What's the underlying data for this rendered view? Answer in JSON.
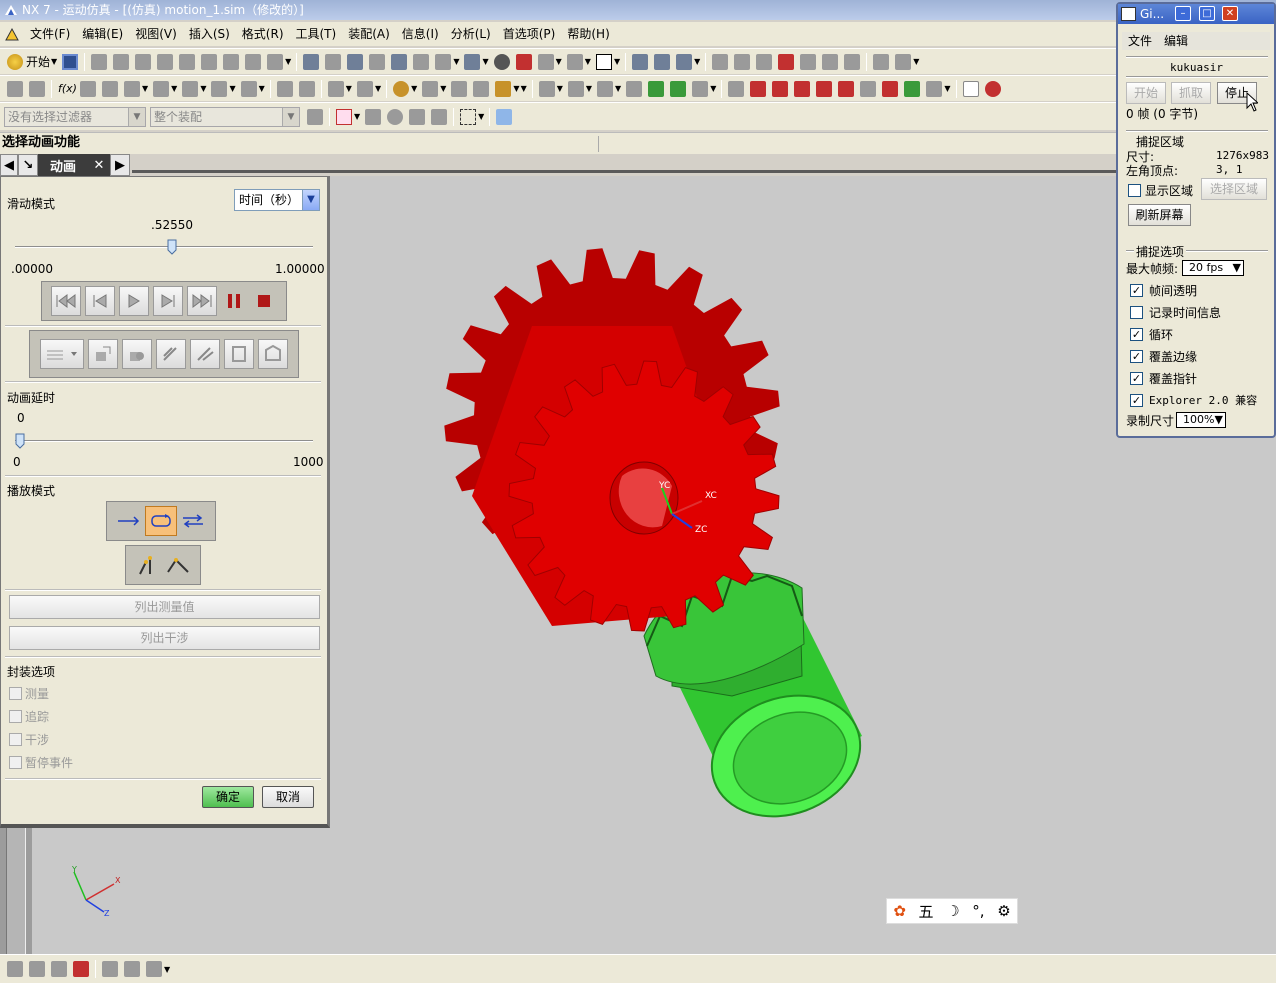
{
  "window": {
    "title": "NX 7 - 运动仿真 - [(仿真) motion_1.sim（修改的）]"
  },
  "menu": [
    "文件(F)",
    "编辑(E)",
    "视图(V)",
    "插入(S)",
    "格式(R)",
    "工具(T)",
    "装配(A)",
    "信息(I)",
    "分析(L)",
    "首选项(P)",
    "帮助(H)"
  ],
  "toolbar": {
    "start_label": "开始"
  },
  "filters": {
    "selection_filter": "没有选择过滤器",
    "scope": "整个装配"
  },
  "cue": {
    "text": "选择动画功能"
  },
  "tab": {
    "label": "动画"
  },
  "animation": {
    "slide_mode_label": "滑动模式",
    "slide_mode_value": "时间（秒）",
    "slider_value": ".52550",
    "slider_fraction": 0.5255,
    "slider_min": ".00000",
    "slider_max": "1.00000",
    "delay_label": "动画延时",
    "delay_value": "0",
    "delay_fraction": 0,
    "delay_min": "0",
    "delay_max": "1000",
    "playback_label": "播放模式",
    "list_measures": "列出测量值",
    "list_interference": "列出干涉",
    "envelope_label": "封装选项",
    "opt_measure": "测量",
    "opt_trace": "追踪",
    "opt_interference": "干涉",
    "opt_pause": "暂停事件",
    "ok": "确定",
    "cancel": "取消"
  },
  "gif": {
    "title": "Gi...",
    "menu_file": "文件",
    "menu_edit": "编辑",
    "author": "kukuasir",
    "btn_start": "开始",
    "btn_capture": "抓取",
    "btn_stop": "停止",
    "frames": "0 帧 (0 字节)",
    "capture_area_label": "捕捉区域",
    "size_label": "尺寸:",
    "size_value": "1276x983",
    "corner_label": "左角顶点:",
    "corner_value": "3, 1",
    "show_area": "显示区域",
    "select_area": "选择区域",
    "refresh": "刷新屏幕",
    "capture_opts_label": "捕捉选项",
    "max_fps_label": "最大帧频:",
    "max_fps_value": "20 fps",
    "opt_transparent": "帧间透明",
    "opt_timeinfo": "记录时间信息",
    "opt_loop": "循环",
    "opt_cover_edge": "覆盖边缘",
    "opt_cover_cursor": "覆盖指针",
    "opt_explorer": "Explorer 2.0 兼容",
    "rec_size_label": "录制尺寸",
    "rec_size_value": "100%"
  },
  "axes": {
    "yc": "YC",
    "xc": "XC",
    "zc": "ZC",
    "x": "X",
    "y": "Y",
    "z": "Z"
  },
  "ime": {
    "char": "五"
  },
  "colors": {
    "gear_red": "#e00000",
    "gear_green": "#33dd33",
    "viewport": "#c9c9c9"
  }
}
